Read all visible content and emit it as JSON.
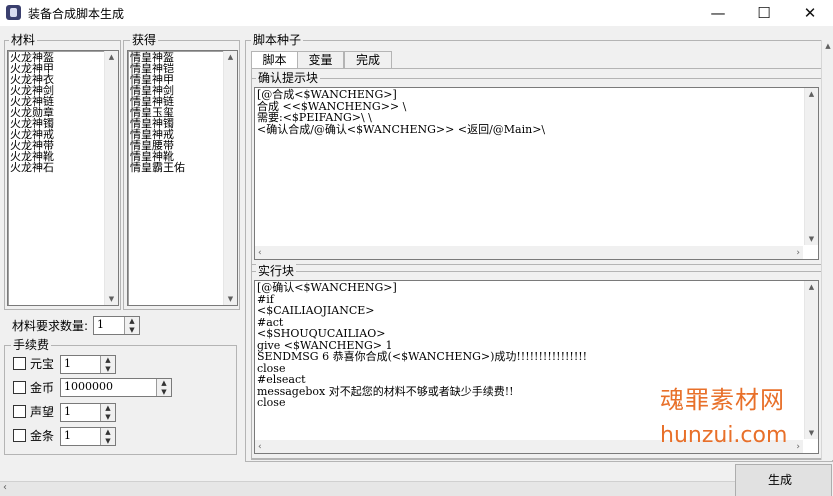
{
  "window": {
    "title": "装备合成脚本生成"
  },
  "materials": {
    "label": "材料",
    "items": [
      "火龙神盔",
      "火龙神甲",
      "火龙神衣",
      "火龙神剑",
      "火龙神链",
      "火龙勋章",
      "火龙神镯",
      "火龙神戒",
      "火龙神带",
      "火龙神靴",
      "火龙神石"
    ]
  },
  "obtain": {
    "label": "获得",
    "items": [
      "情皇神盔",
      "情皇神铠",
      "情皇神甲",
      "情皇神剑",
      "情皇神链",
      "情皇玉玺",
      "情皇神镯",
      "情皇神戒",
      "情皇腰带",
      "情皇神靴",
      "情皇霸王佑"
    ]
  },
  "required_count": {
    "label": "材料要求数量:",
    "value": "1"
  },
  "fees": {
    "label": "手续费",
    "rows": [
      {
        "name": "元宝",
        "value": "1"
      },
      {
        "name": "金币",
        "value": "1000000"
      },
      {
        "name": "声望",
        "value": "1"
      },
      {
        "name": "金条",
        "value": "1"
      }
    ]
  },
  "script_seed": {
    "label": "脚本种子",
    "tabs": [
      "脚本",
      "变量",
      "完成"
    ],
    "confirm_label": "确认提示块",
    "confirm_lines": [
      "[@合成<$WANCHENG>]",
      "合成 <<$WANCHENG>> \\",
      "需要:<$PEIFANG>\\ \\",
      "<确认合成/@确认<$WANCHENG>> <返回/@Main>\\"
    ],
    "exec_label": "实行块",
    "exec_lines": [
      "[@确认<$WANCHENG>]",
      "#if",
      "<$CAILIAOJIANCE>",
      "#act",
      "<$SHOUQUCAILIAO>",
      "give <$WANCHENG> 1",
      "SENDMSG 6 恭喜你合成(<$WANCHENG>)成功!!!!!!!!!!!!!!!!",
      "close",
      "#elseact",
      "messagebox 对不起您的材料不够或者缺少手续费!!",
      "close"
    ]
  },
  "generate_label": "生成",
  "watermark": {
    "line1": "魂罪素材网",
    "line2": "hunzui.com"
  }
}
